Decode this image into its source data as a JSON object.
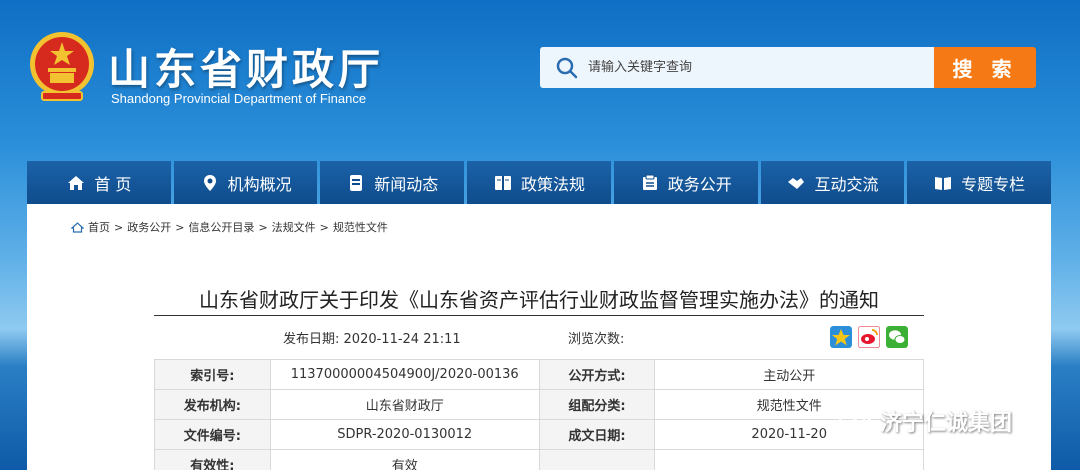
{
  "header": {
    "title": "山东省财政厅",
    "subtitle": "Shandong Provincial Department of Finance",
    "search_placeholder": "请输入关键字查询",
    "search_button": "搜 索"
  },
  "nav": {
    "items": [
      {
        "label": "首 页",
        "icon": "home-icon"
      },
      {
        "label": "机构概况",
        "icon": "location-pin-icon"
      },
      {
        "label": "新闻动态",
        "icon": "document-icon"
      },
      {
        "label": "政策法规",
        "icon": "book-icon"
      },
      {
        "label": "政务公开",
        "icon": "notice-board-icon"
      },
      {
        "label": "互动交流",
        "icon": "handshake-icon"
      },
      {
        "label": "专题专栏",
        "icon": "open-book-icon"
      }
    ]
  },
  "breadcrumb": {
    "items": [
      "首页",
      "政务公开",
      "信息公开目录",
      "法规文件",
      "规范性文件"
    ],
    "separator": ">"
  },
  "article": {
    "title": "山东省财政厅关于印发《山东省资产评估行业财政监督管理实施办法》的通知",
    "publish_date_label": "发布日期:",
    "publish_date": "2020-11-24 21:11",
    "views_label": "浏览次数:",
    "share_icons": [
      "qzone-star-icon",
      "weibo-icon",
      "wechat-icon"
    ]
  },
  "info_table": {
    "rows": [
      {
        "l1": "索引号:",
        "v1": "11370000004504900J/2020-00136",
        "l2": "公开方式:",
        "v2": "主动公开"
      },
      {
        "l1": "发布机构:",
        "v1": "山东省财政厅",
        "l2": "组配分类:",
        "v2": "规范性文件"
      },
      {
        "l1": "文件编号:",
        "v1": "SDPR-2020-0130012",
        "l2": "成文日期:",
        "v2": "2020-11-20"
      },
      {
        "l1": "有效性:",
        "v1": "有效",
        "l2": "",
        "v2": ""
      }
    ]
  },
  "watermark": {
    "text": "济宁仁诚集团"
  },
  "colors": {
    "nav_bg": "#0f4c8c",
    "search_button": "#f57a16",
    "emblem_red": "#d62a1e",
    "emblem_gold": "#f2c230"
  }
}
